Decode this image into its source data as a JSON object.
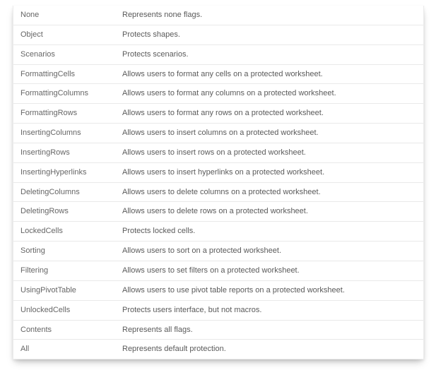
{
  "rows": [
    {
      "name": "None",
      "desc": "Represents none flags."
    },
    {
      "name": "Object",
      "desc": "Protects shapes."
    },
    {
      "name": "Scenarios",
      "desc": "Protects scenarios."
    },
    {
      "name": "FormattingCells",
      "desc": "Allows users to format any cells on a protected worksheet."
    },
    {
      "name": "FormattingColumns",
      "desc": "Allows users to format any columns on a protected worksheet."
    },
    {
      "name": "FormattingRows",
      "desc": "Allows users to format any rows on a protected worksheet."
    },
    {
      "name": "InsertingColumns",
      "desc": "Allows users to insert columns on a protected worksheet."
    },
    {
      "name": "InsertingRows",
      "desc": "Allows users to insert rows on a protected worksheet."
    },
    {
      "name": "InsertingHyperlinks",
      "desc": "Allows users to insert hyperlinks on a protected worksheet."
    },
    {
      "name": "DeletingColumns",
      "desc": "Allows users to delete columns on a protected worksheet."
    },
    {
      "name": "DeletingRows",
      "desc": "Allows users to delete rows on a protected worksheet."
    },
    {
      "name": "LockedCells",
      "desc": "Protects locked cells."
    },
    {
      "name": "Sorting",
      "desc": "Allows users to sort on a protected worksheet."
    },
    {
      "name": "Filtering",
      "desc": "Allows users to set filters on a protected worksheet."
    },
    {
      "name": "UsingPivotTable",
      "desc": "Allows users to use pivot table reports on a protected worksheet."
    },
    {
      "name": "UnlockedCells",
      "desc": "Protects users interface, but not macros."
    },
    {
      "name": "Contents",
      "desc": "Represents all flags."
    },
    {
      "name": "All",
      "desc": "Represents default protection."
    }
  ]
}
